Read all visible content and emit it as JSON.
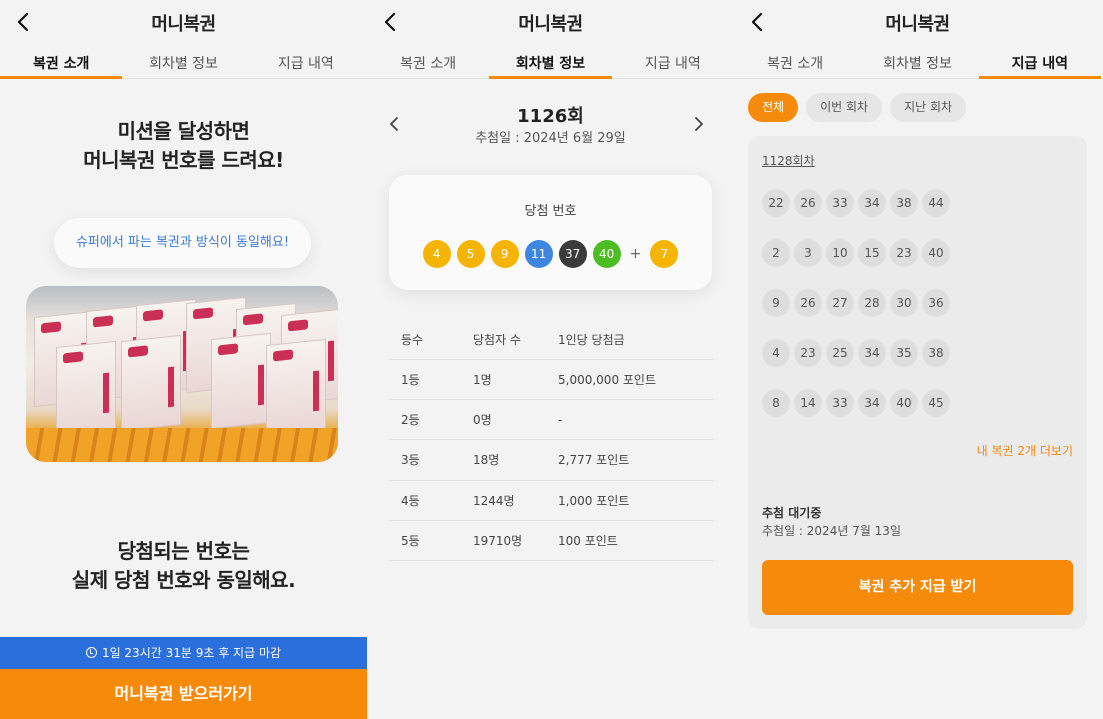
{
  "app_title": "머니복권",
  "tabs": [
    "복권 소개",
    "회차별 정보",
    "지급 내역"
  ],
  "intro": {
    "headline1_line1": "미션을 달성하면",
    "headline1_line2": "머니복권 번호를 드려요!",
    "note": "슈퍼에서 파는 복권과 방식이 동일해요!",
    "headline2_line1": "당첨되는 번호는",
    "headline2_line2": "실제 당첨 번호와 동일해요.",
    "timer": "1일 23시간 31분 9초 후 지급 마감",
    "cta": "머니복권 받으러가기"
  },
  "round_info": {
    "round": "1126회",
    "draw_date": "추첨일 : 2024년 6월 29일",
    "winning_label": "당첨 번호",
    "winning_numbers": [
      {
        "n": "4",
        "color": "#f5b400"
      },
      {
        "n": "5",
        "color": "#f5b400"
      },
      {
        "n": "9",
        "color": "#f5b400"
      },
      {
        "n": "11",
        "color": "#3f86e0"
      },
      {
        "n": "37",
        "color": "#3b3b3b"
      },
      {
        "n": "40",
        "color": "#4cbe23"
      }
    ],
    "plus": "+",
    "bonus_number": {
      "n": "7",
      "color": "#f5b400"
    },
    "table_headers": [
      "등수",
      "당첨자 수",
      "1인당 당첨금"
    ],
    "table_rows": [
      [
        "1등",
        "1명",
        "5,000,000 포인트"
      ],
      [
        "2등",
        "0명",
        "-"
      ],
      [
        "3등",
        "18명",
        "2,777 포인트"
      ],
      [
        "4등",
        "1244명",
        "1,000 포인트"
      ],
      [
        "5등",
        "19710명",
        "100 포인트"
      ]
    ]
  },
  "payout": {
    "filters": [
      "전체",
      "이번 회차",
      "지난 회차"
    ],
    "round_link": "1128회차",
    "tickets": [
      [
        "22",
        "26",
        "33",
        "34",
        "38",
        "44"
      ],
      [
        "2",
        "3",
        "10",
        "15",
        "23",
        "40"
      ],
      [
        "9",
        "26",
        "27",
        "28",
        "30",
        "36"
      ],
      [
        "4",
        "23",
        "25",
        "34",
        "35",
        "38"
      ],
      [
        "8",
        "14",
        "33",
        "34",
        "40",
        "45"
      ]
    ],
    "more": "내 복권 2개 더보기",
    "status": "추첨 대기중",
    "draw_date": "추첨일 : 2024년 7월 13일",
    "cta": "복권 추가 지급 받기"
  },
  "colors": {
    "accent": "#f58a0b",
    "timer_bar": "#2b6fdc"
  }
}
